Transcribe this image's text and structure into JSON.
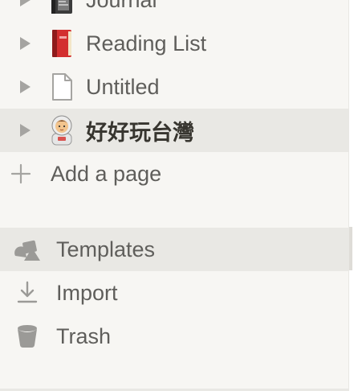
{
  "sidebar": {
    "pages": [
      {
        "label": "Journal",
        "icon": "journal-book-icon"
      },
      {
        "label": "Reading List",
        "icon": "red-book-icon"
      },
      {
        "label": "Untitled",
        "icon": "blank-page-icon"
      },
      {
        "label": "好好玩台灣",
        "icon": "astronaut-emoji-icon",
        "active": true
      }
    ],
    "add_page_label": "Add a page",
    "utilities": [
      {
        "label": "Templates",
        "icon": "templates-icon"
      },
      {
        "label": "Import",
        "icon": "import-icon"
      },
      {
        "label": "Trash",
        "icon": "trash-icon"
      }
    ]
  },
  "colors": {
    "sidebar_bg": "#f7f6f3",
    "hover_bg": "#e9e8e4",
    "text": "#5f5e5b",
    "active_text": "#37352f",
    "icon_gray": "#a5a4a1"
  }
}
